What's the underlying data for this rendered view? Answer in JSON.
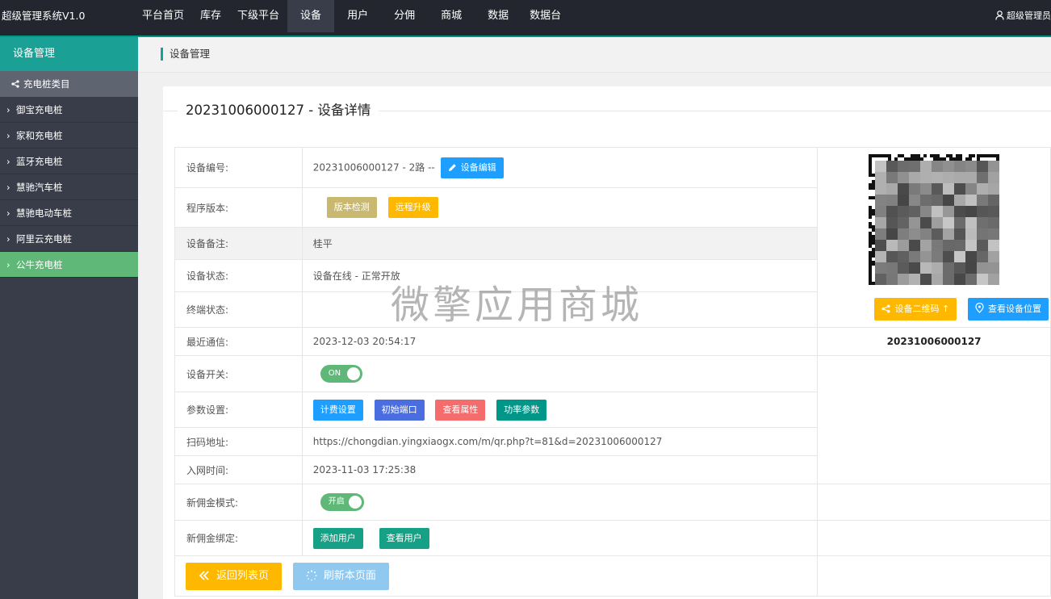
{
  "app": {
    "title": "超级管理系统V1.0",
    "user": "超级管理员"
  },
  "topnav": [
    "平台首页",
    "库存",
    "下级平台",
    "设备",
    "用户",
    "分佣",
    "商城",
    "数据",
    "数据台"
  ],
  "sidebar": {
    "header": "设备管理",
    "category": "充电桩类目",
    "items": [
      "御宝充电桩",
      "家和充电桩",
      "蓝牙充电桩",
      "慧驰汽车桩",
      "慧驰电动车桩",
      "阿里云充电桩",
      "公牛充电桩"
    ],
    "active_index": 6
  },
  "breadcrumb": "设备管理",
  "page": {
    "title": "20231006000127 - 设备详情"
  },
  "rows": {
    "device_no": {
      "label": "设备编号:",
      "value": "20231006000127 - 2路 --",
      "edit_btn": "设备编辑"
    },
    "firmware": {
      "label": "程序版本:",
      "check_btn": "版本检测",
      "upgrade_btn": "远程升级"
    },
    "remark": {
      "label": "设备备注:",
      "value": "桂平"
    },
    "status": {
      "label": "设备状态:",
      "value": "设备在线 - 正常开放"
    },
    "terminal": {
      "label": "终端状态:"
    },
    "last_comm": {
      "label": "最近通信:",
      "value": "2023-12-03 20:54:17"
    },
    "switch": {
      "label": "设备开关:",
      "toggle": "ON"
    },
    "params": {
      "label": "参数设置:",
      "buttons": [
        "计费设置",
        "初始端口",
        "查看属性",
        "功率参数"
      ]
    },
    "scan_url": {
      "label": "扫码地址:",
      "value": "https://chongdian.yingxiaogx.com/m/qr.php?t=81&d=20231006000127"
    },
    "join_time": {
      "label": "入网时间:",
      "value": "2023-11-03 17:25:38"
    },
    "commission_mode": {
      "label": "新佣金模式:",
      "toggle": "开启"
    },
    "commission_bind": {
      "label": "新佣金绑定:",
      "add_btn": "添加用户",
      "view_btn": "查看用户"
    }
  },
  "side_panel": {
    "qr_btn": "设备二维码",
    "location_btn": "查看设备位置",
    "code": "20231006000127"
  },
  "footer": {
    "back_btn": "返回列表页",
    "refresh_btn": "刷新本页面"
  },
  "watermark": "微擎应用商城",
  "colors": {
    "topbar": "#23262e",
    "accent": "#009688",
    "sidebar": "#393d49",
    "active_green": "#5fb878",
    "blue": "#1e9fff",
    "yellow": "#ffb800"
  }
}
